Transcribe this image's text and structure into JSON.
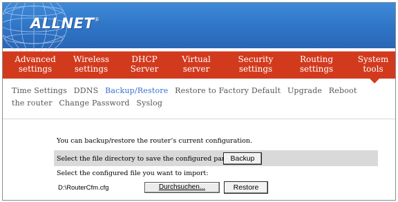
{
  "brand": {
    "logo_text": "ALLNET",
    "trademark": "®"
  },
  "nav": {
    "items": [
      {
        "line1": "Advanced",
        "line2": "settings"
      },
      {
        "line1": "Wireless",
        "line2": "settings"
      },
      {
        "line1": "DHCP",
        "line2": "Server"
      },
      {
        "line1": "Virtual",
        "line2": "server"
      },
      {
        "line1": "Security",
        "line2": "settings"
      },
      {
        "line1": "Routing",
        "line2": "settings"
      },
      {
        "line1": "System",
        "line2": "tools"
      }
    ],
    "active": "System tools"
  },
  "subnav": {
    "items": [
      "Time Settings",
      "DDNS",
      "Backup/Restore",
      "Restore to Factory Default",
      "Upgrade",
      "Reboot the router",
      "Change Password",
      "Syslog"
    ],
    "current": "Backup/Restore"
  },
  "main": {
    "intro": "You can backup/restore the router’s current configuration.",
    "backup_label": "Select the file directory to save the configured parameters:",
    "backup_button": "Backup",
    "import_label": "Select the configured file you want to import:",
    "file_path": "D:\\RouterCfm.cfg",
    "browse_button": "Durchsuchen...",
    "restore_button": "Restore"
  },
  "colors": {
    "header_blue": "#2f74c6",
    "nav_red": "#d23a1e",
    "current_link": "#3a6fd0"
  }
}
